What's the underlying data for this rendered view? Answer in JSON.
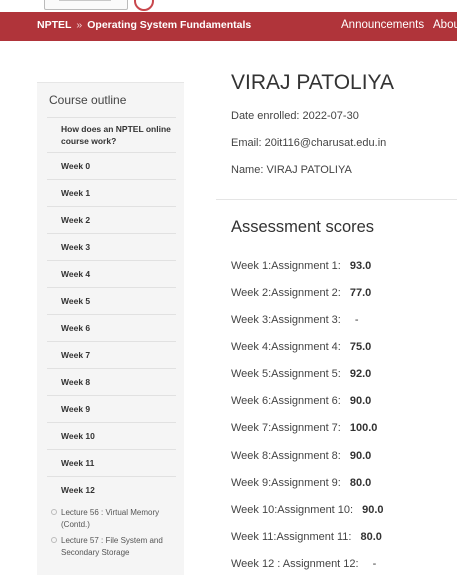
{
  "header": {
    "breadcrumb": {
      "root": "NPTEL",
      "separator": "»",
      "course": "Operating System Fundamentals"
    },
    "nav": [
      "Announcements",
      "Abou"
    ],
    "brand_color": "#b0343a"
  },
  "sidebar": {
    "title": "Course outline",
    "intro": "How does an NPTEL online course work?",
    "weeks": [
      "Week 0",
      "Week 1",
      "Week 2",
      "Week 3",
      "Week 4",
      "Week 5",
      "Week 6",
      "Week 7",
      "Week 8",
      "Week 9",
      "Week 10",
      "Week 11",
      "Week 12"
    ],
    "lectures": [
      "Lecture 56 : Virtual Memory (Contd.)",
      "Lecture 57 : File System and Secondary Storage"
    ]
  },
  "profile": {
    "name_heading": "VIRAJ PATOLIYA",
    "date_enrolled": "Date enrolled: 2022-07-30",
    "email": "Email: 20it116@charusat.edu.in",
    "name": "Name: VIRAJ PATOLIYA"
  },
  "scores": {
    "title": "Assessment scores",
    "items": [
      {
        "label": "Week 1:Assignment 1:",
        "value": "93.0"
      },
      {
        "label": "Week 2:Assignment 2:",
        "value": "77.0"
      },
      {
        "label": "Week 3:Assignment 3:",
        "value": "-"
      },
      {
        "label": "Week 4:Assignment 4:",
        "value": "75.0"
      },
      {
        "label": "Week 5:Assignment 5:",
        "value": "92.0"
      },
      {
        "label": "Week 6:Assignment 6:",
        "value": "90.0"
      },
      {
        "label": "Week 7:Assignment 7:",
        "value": "100.0"
      },
      {
        "label": "Week 8:Assignment 8:",
        "value": "90.0"
      },
      {
        "label": "Week 9:Assignment 9:",
        "value": "80.0"
      },
      {
        "label": "Week 10:Assignment 10:",
        "value": "90.0"
      },
      {
        "label": "Week 11:Assignment 11:",
        "value": "80.0"
      },
      {
        "label": "Week 12 : Assignment 12:",
        "value": "-"
      }
    ]
  }
}
